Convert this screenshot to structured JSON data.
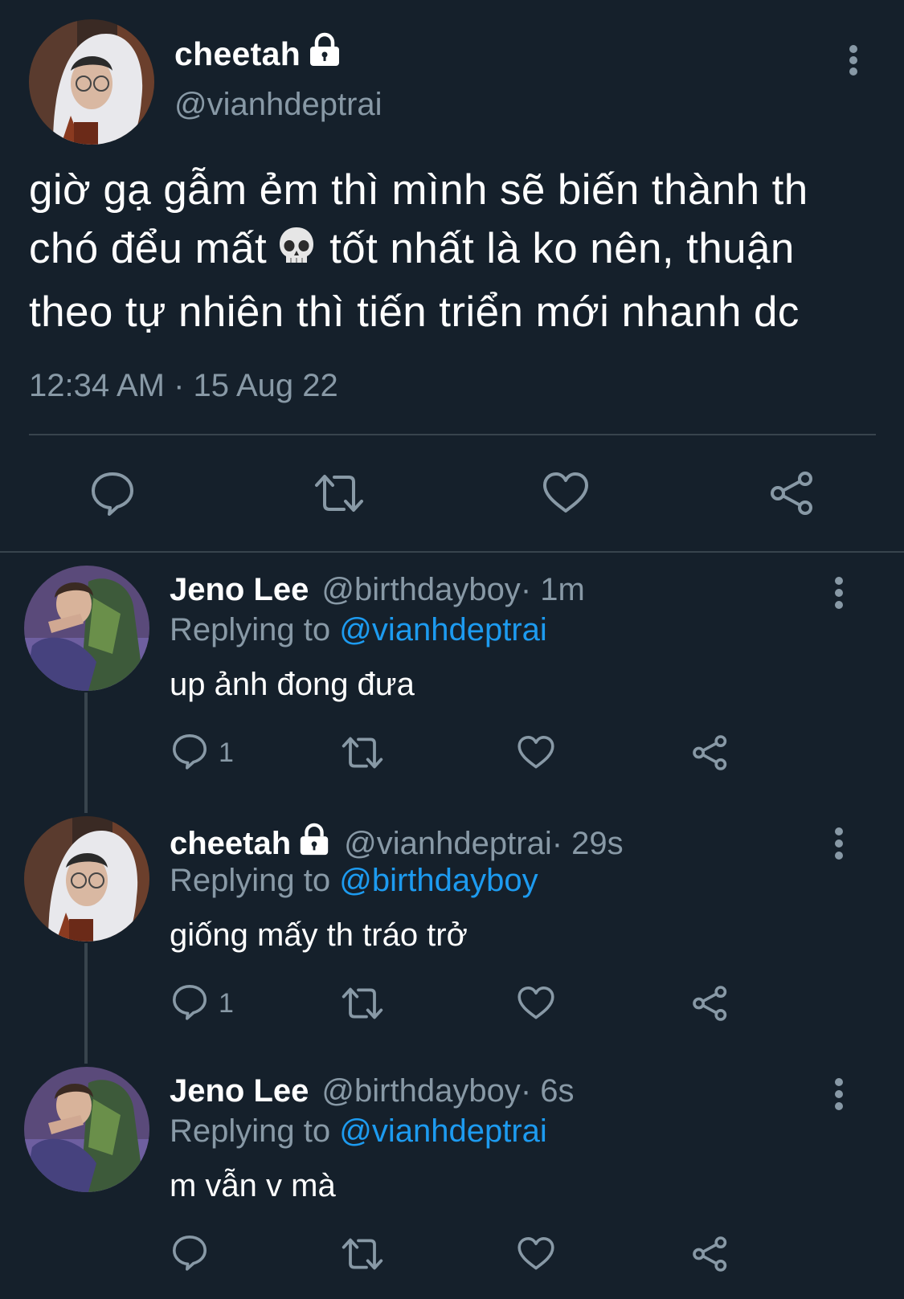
{
  "tweet": {
    "author_name": "cheetah",
    "author_handle": "@vianhdeptrai",
    "text_part1": "giờ gạ gẫm ẻm thì mình sẽ biến thành th chó đểu mất",
    "text_part2": "tốt nhất là ko nên, thuận theo tự nhiên thì tiến triển mới nhanh dc",
    "emoji": "skull",
    "timestamp": "12:34 AM · 15 Aug 22",
    "icons": [
      "reply-icon",
      "retweet-icon",
      "like-icon",
      "share-icon"
    ]
  },
  "replies": [
    {
      "author_name": "Jeno Lee",
      "author_handle": "@birthdayboy",
      "time": " · 1m",
      "locked": false,
      "replying_label": "Replying to ",
      "replying_to": "@vianhdeptrai",
      "text": "up ảnh đong đưa",
      "reply_count": "1"
    },
    {
      "author_name": "cheetah",
      "author_handle": "@vianhdeptrai",
      "time": " · 29s",
      "locked": true,
      "replying_label": "Replying to ",
      "replying_to": "@birthdayboy",
      "text": "giống mấy th tráo trở",
      "reply_count": "1"
    },
    {
      "author_name": "Jeno Lee",
      "author_handle": "@birthdayboy",
      "time": " · 6s",
      "locked": false,
      "replying_label": "Replying to ",
      "replying_to": "@vianhdeptrai",
      "text": "m vẫn v mà",
      "reply_count": ""
    }
  ],
  "colors": {
    "background": "#15202b",
    "secondary_text": "#8899a6",
    "mention": "#1d9bf0",
    "divider": "#38444d"
  }
}
